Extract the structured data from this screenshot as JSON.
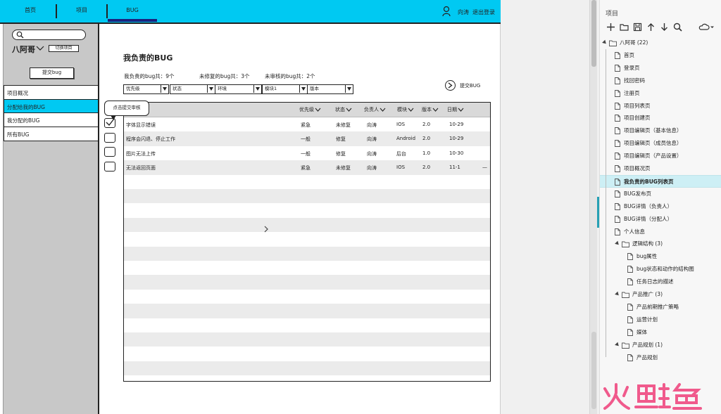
{
  "topnav": {
    "items": [
      "首页",
      "项目",
      "BUG"
    ],
    "user_name": "向涛",
    "logout": "退出登录"
  },
  "sidebar": {
    "user": "八阿哥",
    "switch_project": "切换项目",
    "submit_bug": "提交bug",
    "menu": [
      "项目概况",
      "分配给我的BUG",
      "我分配的BUG",
      "所有BUG"
    ],
    "active_index": 1
  },
  "main": {
    "title": "我负责的BUG",
    "stats": [
      "我负责的bug共：9个",
      "未修复的bug共：3个",
      "未审核的bug共：2个"
    ],
    "filters": [
      "优先级",
      "状态",
      "环境",
      "模块1",
      "版本"
    ],
    "submit_bug_link": "提交BUG",
    "tooltip": "点击提交审核",
    "columns": [
      "优先级",
      "状态",
      "负责人",
      "模块",
      "版本",
      "日期"
    ],
    "rows": [
      {
        "title": "字体显示错误",
        "priority": "紧急",
        "status": "未修复",
        "owner": "向涛",
        "module": "IOS",
        "version": "2.0",
        "date": "10-29",
        "checked": true
      },
      {
        "title": "程序会闪退、停止工作",
        "priority": "一般",
        "status": "修复",
        "owner": "向涛",
        "module": "Android",
        "version": "2.0",
        "date": "10-29",
        "checked": false
      },
      {
        "title": "图片无法上传",
        "priority": "一般",
        "status": "修复",
        "owner": "向涛",
        "module": "后台",
        "version": "1.0",
        "date": "10-30",
        "checked": false
      },
      {
        "title": "无法返回页面",
        "priority": "紧急",
        "status": "未修复",
        "owner": "向涛",
        "module": "IOS",
        "version": "2.0",
        "date": "11-1",
        "checked": false
      }
    ],
    "row_more": "—"
  },
  "project_panel": {
    "title": "项目",
    "root": "八阿哥 (22)",
    "pages": [
      "首页",
      "登录页",
      "找回密码",
      "注册页",
      "项目列表页",
      "项目创建页",
      "项目编辑页（基本信息）",
      "项目编辑页（成员信息）",
      "项目编辑页（产品设置）",
      "项目概况页",
      "我负责的BUG列表页",
      "BUG发布页",
      "BUG详情（负责人）",
      "BUG详情（分配人）",
      "个人信息"
    ],
    "selected": "我负责的BUG列表页",
    "folders": [
      {
        "name": "逻辑结构 (3)",
        "children": [
          "bug属性",
          "bug状态和动作的结构图",
          "任务日志的描述"
        ]
      },
      {
        "name": "产品推广 (3)",
        "children": [
          "产品前期推广策略",
          "运营计划",
          "媒体"
        ]
      },
      {
        "name": "产品规划 (1)",
        "children": [
          "产品规划"
        ]
      }
    ]
  },
  "watermark": "火鲤鱼",
  "colors": {
    "accent": "#00c9f2",
    "selected_row": "#cdeff5",
    "watermark": "#f05a8c"
  }
}
